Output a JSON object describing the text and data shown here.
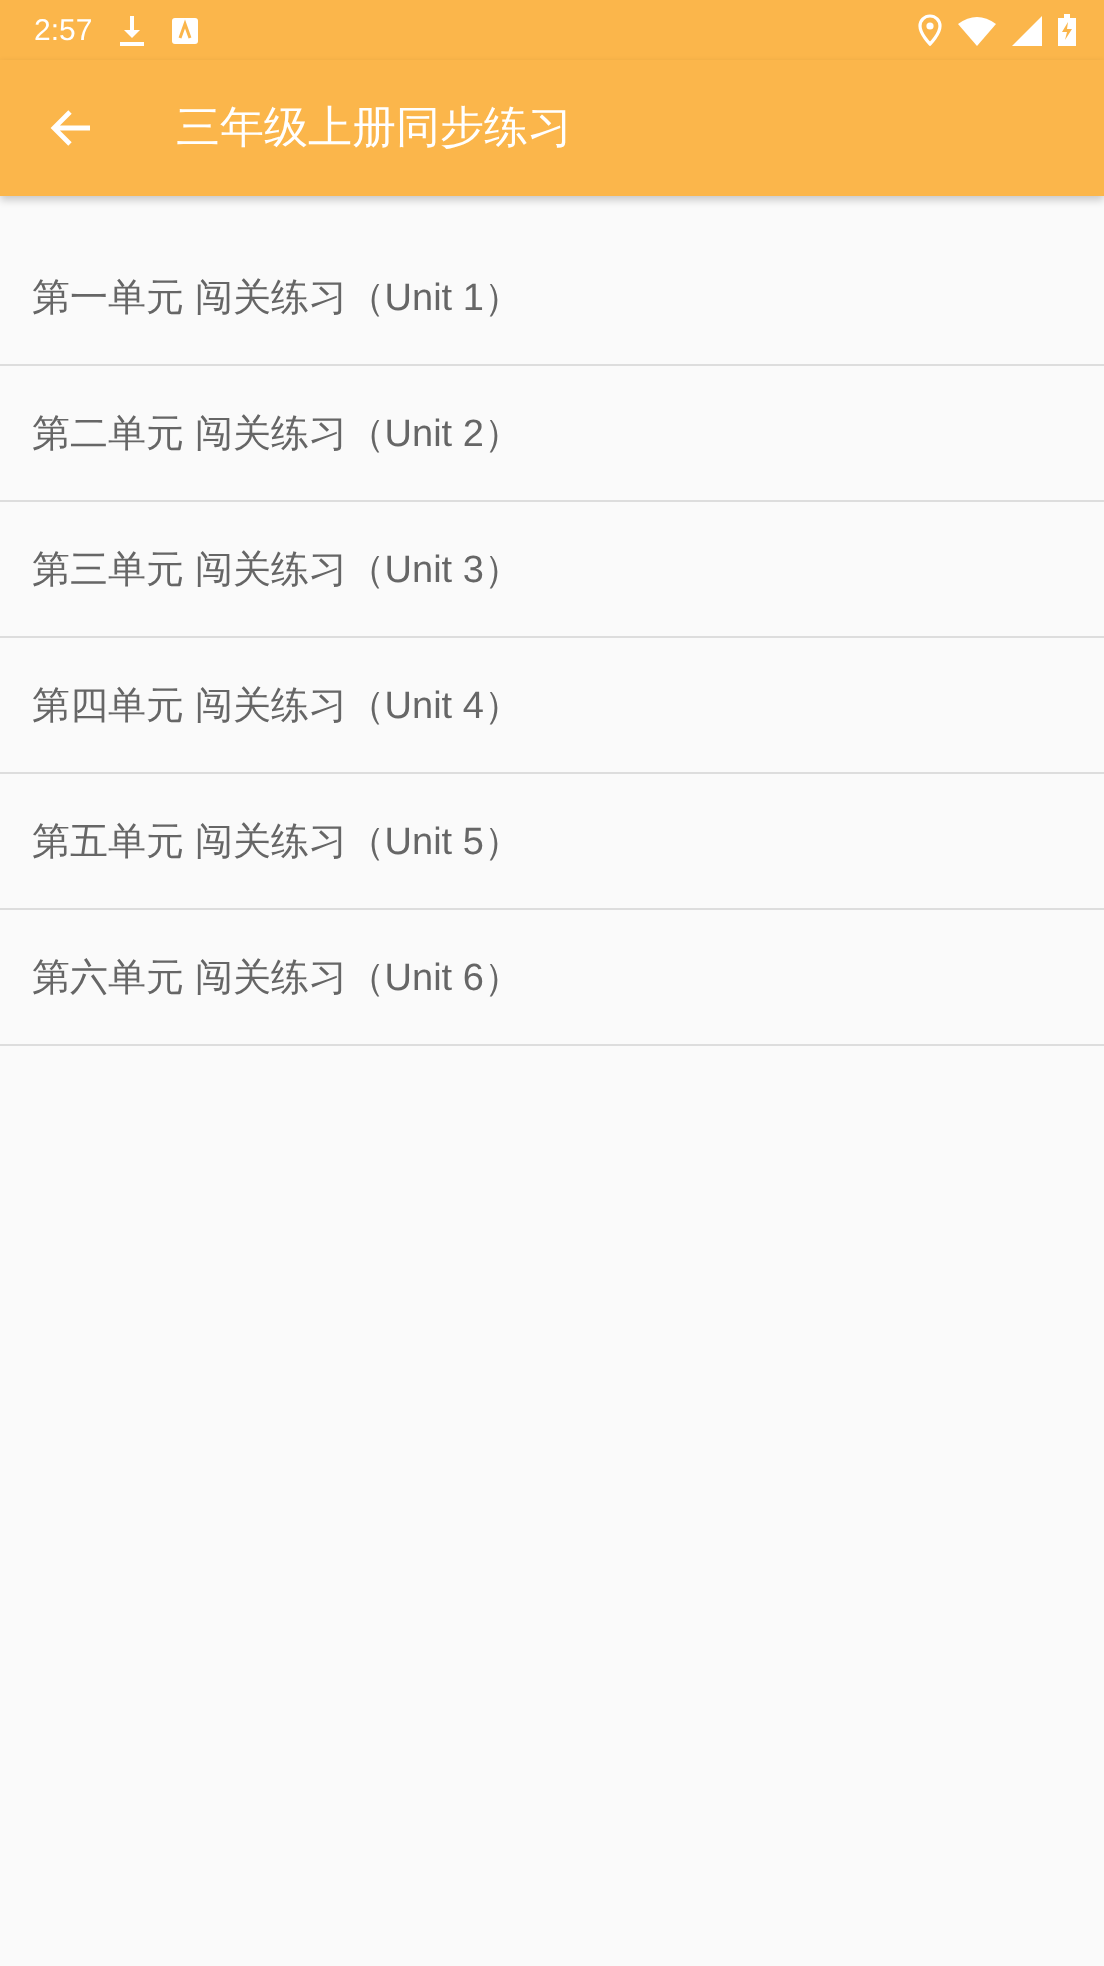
{
  "status_bar": {
    "time": "2:57"
  },
  "app_bar": {
    "title": "三年级上册同步练习"
  },
  "units": [
    {
      "label": "第一单元 闯关练习（Unit 1）"
    },
    {
      "label": "第二单元 闯关练习（Unit 2）"
    },
    {
      "label": "第三单元 闯关练习（Unit 3）"
    },
    {
      "label": "第四单元 闯关练习（Unit 4）"
    },
    {
      "label": "第五单元 闯关练习（Unit 5）"
    },
    {
      "label": "第六单元 闯关练习（Unit 6）"
    }
  ]
}
